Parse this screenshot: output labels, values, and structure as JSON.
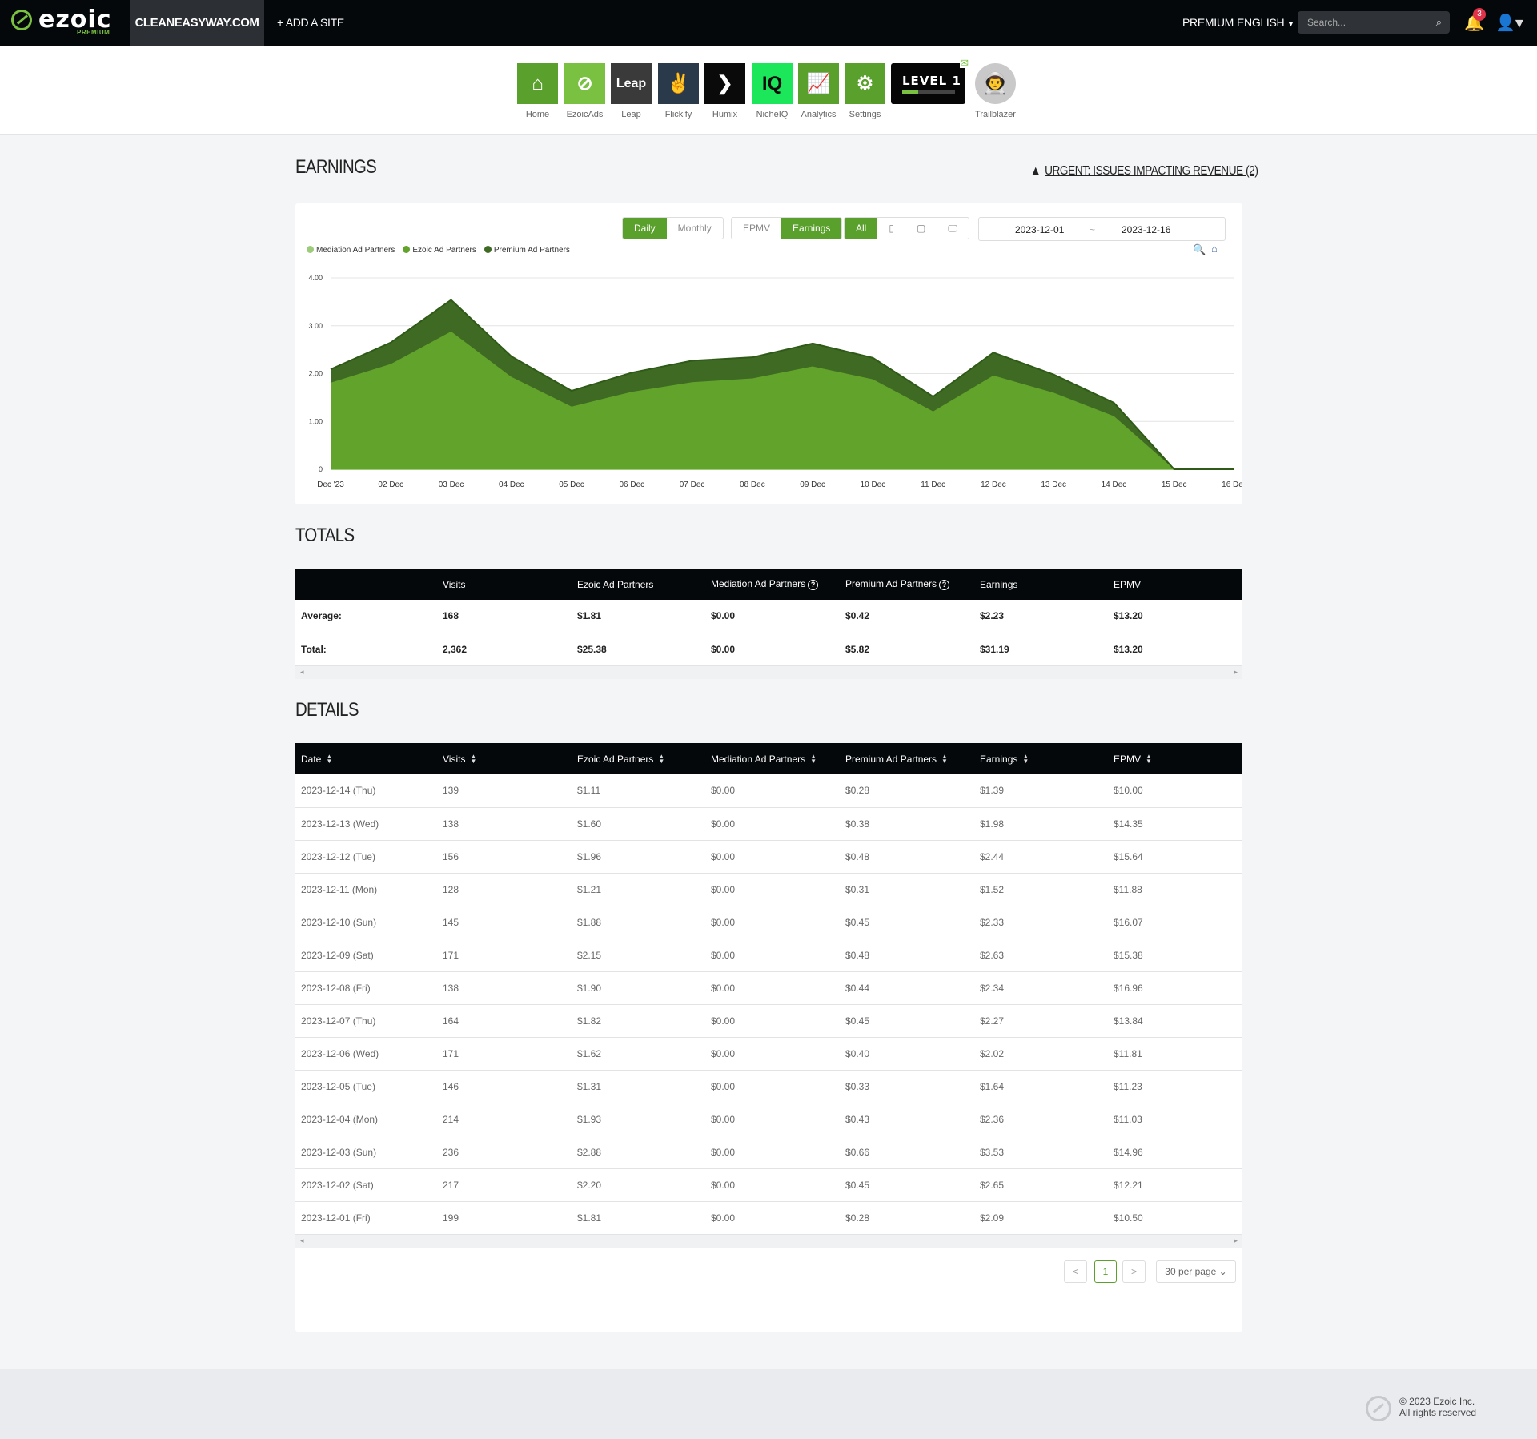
{
  "topbar": {
    "logo_text": "ezoic",
    "logo_sub": "PREMIUM",
    "site": "CLEANEASYWAY.COM",
    "add_site": "+ ADD A SITE",
    "premium": "PREMIUM",
    "language": "ENGLISH",
    "search_placeholder": "Search...",
    "notification_count": "3"
  },
  "apps": [
    {
      "label": "Home",
      "icon": "home-icon",
      "color": "#5aa02c",
      "glyph": "⌂"
    },
    {
      "label": "EzoicAds",
      "icon": "ezoicads-icon",
      "color": "#7ac142",
      "glyph": "⊘"
    },
    {
      "label": "Leap",
      "icon": "leap-icon",
      "color": "#3a3a3a",
      "glyph": "Leap"
    },
    {
      "label": "Flickify",
      "icon": "flickify-icon",
      "color": "#2a3a4a",
      "glyph": "✌"
    },
    {
      "label": "Humix",
      "icon": "humix-icon",
      "color": "#0a0a0a",
      "glyph": "❯"
    },
    {
      "label": "NicheIQ",
      "icon": "nicheiq-icon",
      "color": "#1ce65a",
      "glyph": "IQ"
    },
    {
      "label": "Analytics",
      "icon": "analytics-icon",
      "color": "#5aa02c",
      "glyph": "📈"
    },
    {
      "label": "Settings",
      "icon": "gear-icon",
      "color": "#5aa02c",
      "glyph": "⚙"
    }
  ],
  "level_badge": {
    "text": "LEVEL 1",
    "progress": 0.3
  },
  "trailblazer": {
    "label": "Trailblazer"
  },
  "earnings": {
    "title": "EARNINGS",
    "urgent": "URGENT: ISSUES IMPACTING REVENUE (2)",
    "period_buttons": [
      "Daily",
      "Monthly"
    ],
    "metric_buttons": [
      "EPMV",
      "Earnings"
    ],
    "device_buttons": [
      "All"
    ],
    "date_from": "2023-12-01",
    "date_sep": "~",
    "date_to": "2023-12-16"
  },
  "chart_data": {
    "type": "area",
    "stacked": true,
    "x": [
      "Dec '23",
      "02 Dec",
      "03 Dec",
      "04 Dec",
      "05 Dec",
      "06 Dec",
      "07 Dec",
      "08 Dec",
      "09 Dec",
      "10 Dec",
      "11 Dec",
      "12 Dec",
      "13 Dec",
      "14 Dec",
      "15 Dec",
      "16 Dec"
    ],
    "series": [
      {
        "name": "Mediation Ad Partners",
        "color": "#9ccb7a",
        "values": [
          0,
          0,
          0,
          0,
          0,
          0,
          0,
          0,
          0,
          0,
          0,
          0,
          0,
          0,
          0,
          0
        ]
      },
      {
        "name": "Ezoic Ad Partners",
        "color": "#62a32b",
        "values": [
          1.81,
          2.2,
          2.88,
          1.93,
          1.31,
          1.62,
          1.82,
          1.9,
          2.15,
          1.88,
          1.21,
          1.96,
          1.6,
          1.11,
          0,
          0
        ]
      },
      {
        "name": "Premium Ad Partners",
        "color": "#3f6a24",
        "values": [
          0.28,
          0.45,
          0.66,
          0.43,
          0.33,
          0.4,
          0.45,
          0.44,
          0.48,
          0.45,
          0.31,
          0.48,
          0.38,
          0.28,
          0,
          0
        ]
      }
    ],
    "y_ticks": [
      "0",
      "1.00",
      "2.00",
      "3.00",
      "4.00"
    ],
    "ylim": [
      0,
      4
    ],
    "grid": true,
    "legend": "top-left"
  },
  "totals": {
    "title": "TOTALS",
    "headers": [
      "",
      "Visits",
      "Ezoic Ad Partners",
      "Mediation Ad Partners",
      "Premium Ad Partners",
      "Earnings",
      "EPMV"
    ],
    "rows": [
      [
        "Average:",
        "168",
        "$1.81",
        "$0.00",
        "$0.42",
        "$2.23",
        "$13.20"
      ],
      [
        "Total:",
        "2,362",
        "$25.38",
        "$0.00",
        "$5.82",
        "$31.19",
        "$13.20"
      ]
    ]
  },
  "details": {
    "title": "DETAILS",
    "headers": [
      "Date",
      "Visits",
      "Ezoic Ad Partners",
      "Mediation Ad Partners",
      "Premium Ad Partners",
      "Earnings",
      "EPMV"
    ],
    "rows": [
      [
        "2023-12-14 (Thu)",
        "139",
        "$1.11",
        "$0.00",
        "$0.28",
        "$1.39",
        "$10.00"
      ],
      [
        "2023-12-13 (Wed)",
        "138",
        "$1.60",
        "$0.00",
        "$0.38",
        "$1.98",
        "$14.35"
      ],
      [
        "2023-12-12 (Tue)",
        "156",
        "$1.96",
        "$0.00",
        "$0.48",
        "$2.44",
        "$15.64"
      ],
      [
        "2023-12-11 (Mon)",
        "128",
        "$1.21",
        "$0.00",
        "$0.31",
        "$1.52",
        "$11.88"
      ],
      [
        "2023-12-10 (Sun)",
        "145",
        "$1.88",
        "$0.00",
        "$0.45",
        "$2.33",
        "$16.07"
      ],
      [
        "2023-12-09 (Sat)",
        "171",
        "$2.15",
        "$0.00",
        "$0.48",
        "$2.63",
        "$15.38"
      ],
      [
        "2023-12-08 (Fri)",
        "138",
        "$1.90",
        "$0.00",
        "$0.44",
        "$2.34",
        "$16.96"
      ],
      [
        "2023-12-07 (Thu)",
        "164",
        "$1.82",
        "$0.00",
        "$0.45",
        "$2.27",
        "$13.84"
      ],
      [
        "2023-12-06 (Wed)",
        "171",
        "$1.62",
        "$0.00",
        "$0.40",
        "$2.02",
        "$11.81"
      ],
      [
        "2023-12-05 (Tue)",
        "146",
        "$1.31",
        "$0.00",
        "$0.33",
        "$1.64",
        "$11.23"
      ],
      [
        "2023-12-04 (Mon)",
        "214",
        "$1.93",
        "$0.00",
        "$0.43",
        "$2.36",
        "$11.03"
      ],
      [
        "2023-12-03 (Sun)",
        "236",
        "$2.88",
        "$0.00",
        "$0.66",
        "$3.53",
        "$14.96"
      ],
      [
        "2023-12-02 (Sat)",
        "217",
        "$2.20",
        "$0.00",
        "$0.45",
        "$2.65",
        "$12.21"
      ],
      [
        "2023-12-01 (Fri)",
        "199",
        "$1.81",
        "$0.00",
        "$0.28",
        "$2.09",
        "$10.50"
      ]
    ],
    "pager": {
      "prev": "<",
      "page": "1",
      "next": ">",
      "per_page": "30 per page"
    }
  },
  "footer": {
    "line1": "© 2023 Ezoic Inc.",
    "line2": "All rights reserved"
  },
  "colors": {
    "accent": "#5aa02c",
    "topbar": "#05080b",
    "table_header": "#05080b"
  }
}
